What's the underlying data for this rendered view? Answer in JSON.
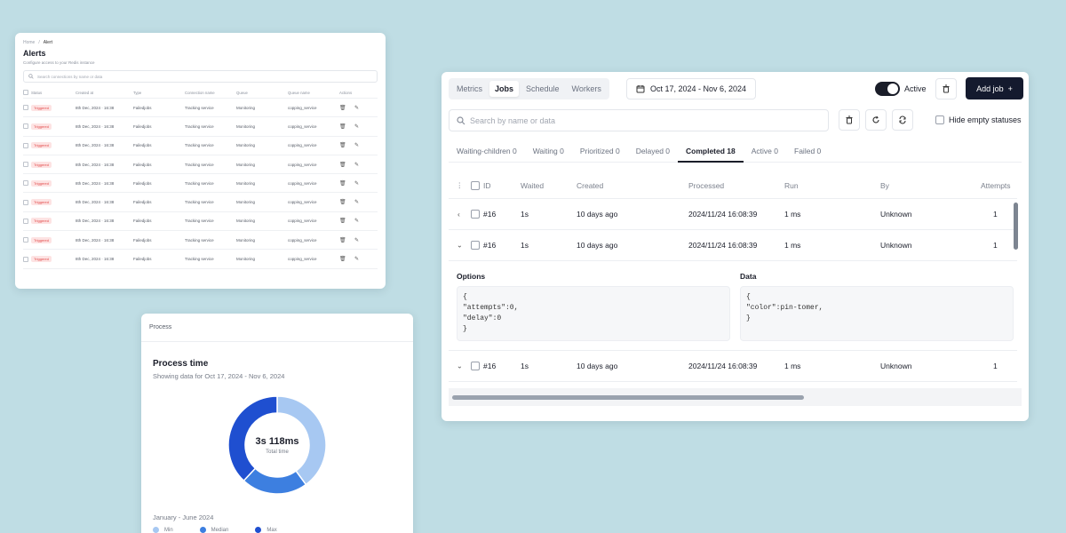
{
  "alerts": {
    "breadcrumb": [
      "Home",
      "/",
      "Alert"
    ],
    "title": "Alerts",
    "subtitle": "Configure access to your Redis instance",
    "search_placeholder": "Search connections by name or data",
    "columns": [
      "Status",
      "Created at",
      "Type",
      "Connection name",
      "Queue",
      "Queue name",
      "Actions"
    ],
    "rows": [
      {
        "status": "Triggered",
        "created": "8th Dec, 2024 · 16:38",
        "type": "Failedjobs",
        "conn": "Tracking service",
        "queue": "Monitoring",
        "qname": "copping_service"
      },
      {
        "status": "Triggered",
        "created": "8th Dec, 2024 · 16:38",
        "type": "Failedjobs",
        "conn": "Tracking service",
        "queue": "Monitoring",
        "qname": "copping_service"
      },
      {
        "status": "Triggered",
        "created": "8th Dec, 2024 · 16:38",
        "type": "Failedjobs",
        "conn": "Tracking service",
        "queue": "Monitoring",
        "qname": "copping_service"
      },
      {
        "status": "Triggered",
        "created": "8th Dec, 2024 · 16:38",
        "type": "Failedjobs",
        "conn": "Tracking service",
        "queue": "Monitoring",
        "qname": "copping_service"
      },
      {
        "status": "Triggered",
        "created": "8th Dec, 2024 · 16:38",
        "type": "Failedjobs",
        "conn": "Tracking service",
        "queue": "Monitoring",
        "qname": "copping_service"
      },
      {
        "status": "Triggered",
        "created": "8th Dec, 2024 · 16:38",
        "type": "Failedjobs",
        "conn": "Tracking service",
        "queue": "Monitoring",
        "qname": "copping_service"
      },
      {
        "status": "Triggered",
        "created": "8th Dec, 2024 · 16:38",
        "type": "Failedjobs",
        "conn": "Tracking service",
        "queue": "Monitoring",
        "qname": "copping_service"
      },
      {
        "status": "Triggered",
        "created": "8th Dec, 2024 · 16:38",
        "type": "Failedjobs",
        "conn": "Tracking service",
        "queue": "Monitoring",
        "qname": "copping_service"
      },
      {
        "status": "Triggered",
        "created": "8th Dec, 2024 · 16:38",
        "type": "Failedjobs",
        "conn": "Tracking service",
        "queue": "Monitoring",
        "qname": "copping_service"
      }
    ],
    "row_icons": [
      "trash-icon",
      "pencil-icon"
    ]
  },
  "process": {
    "header": "Process",
    "title": "Process time",
    "subtitle": "Showing data for Oct 17, 2024 - Nov 6, 2024",
    "center_value": "3s 118ms",
    "center_label": "Total time",
    "range": "January - June 2024",
    "legend": [
      {
        "label": "Min",
        "color": "#a7c8f2"
      },
      {
        "label": "Median",
        "color": "#3d7fe0"
      },
      {
        "label": "Max",
        "color": "#1f4fd0"
      }
    ]
  },
  "chart_data": {
    "type": "pie",
    "donut": true,
    "categories": [
      "Min",
      "Median",
      "Max"
    ],
    "values": [
      40,
      22,
      38
    ],
    "colors": [
      "#a7c8f2",
      "#3d7fe0",
      "#1f4fd0"
    ],
    "center_text": "3s 118ms",
    "center_label": "Total time"
  },
  "jobs": {
    "tabs": [
      "Metrics",
      "Jobs",
      "Schedule",
      "Workers"
    ],
    "selected_tab": 1,
    "date_range": "Oct 17, 2024 - Nov 6, 2024",
    "active_label": "Active",
    "add_job_label": "Add job",
    "search_placeholder": "Search by name or data",
    "hide_empty_label": "Hide empty statuses",
    "status_tabs": [
      "Waiting-children 0",
      "Waiting 0",
      "Prioritized 0",
      "Delayed 0",
      "Completed 18",
      "Active 0",
      "Failed 0"
    ],
    "selected_status": 4,
    "columns": [
      "ID",
      "Waited",
      "Created",
      "Processed",
      "Run",
      "By",
      "Attempts"
    ],
    "rows": [
      {
        "id": "#16",
        "waited": "1s",
        "created": "10 days ago",
        "processed": "2024/11/24 16:08:39",
        "run": "1 ms",
        "by": "Unknown",
        "attempts": "1",
        "expanded": false
      },
      {
        "id": "#16",
        "waited": "1s",
        "created": "10 days ago",
        "processed": "2024/11/24 16:08:39",
        "run": "1 ms",
        "by": "Unknown",
        "attempts": "1",
        "expanded": true
      },
      {
        "id": "#16",
        "waited": "1s",
        "created": "10 days ago",
        "processed": "2024/11/24 16:08:39",
        "run": "1 ms",
        "by": "Unknown",
        "attempts": "1",
        "expanded": false
      }
    ],
    "detail": {
      "options_label": "Options",
      "options_text": "{\n\"attempts\":0,\n\"delay\":0\n}",
      "data_label": "Data",
      "data_text": "{\n\"color\":pin-tomer,\n}"
    }
  }
}
